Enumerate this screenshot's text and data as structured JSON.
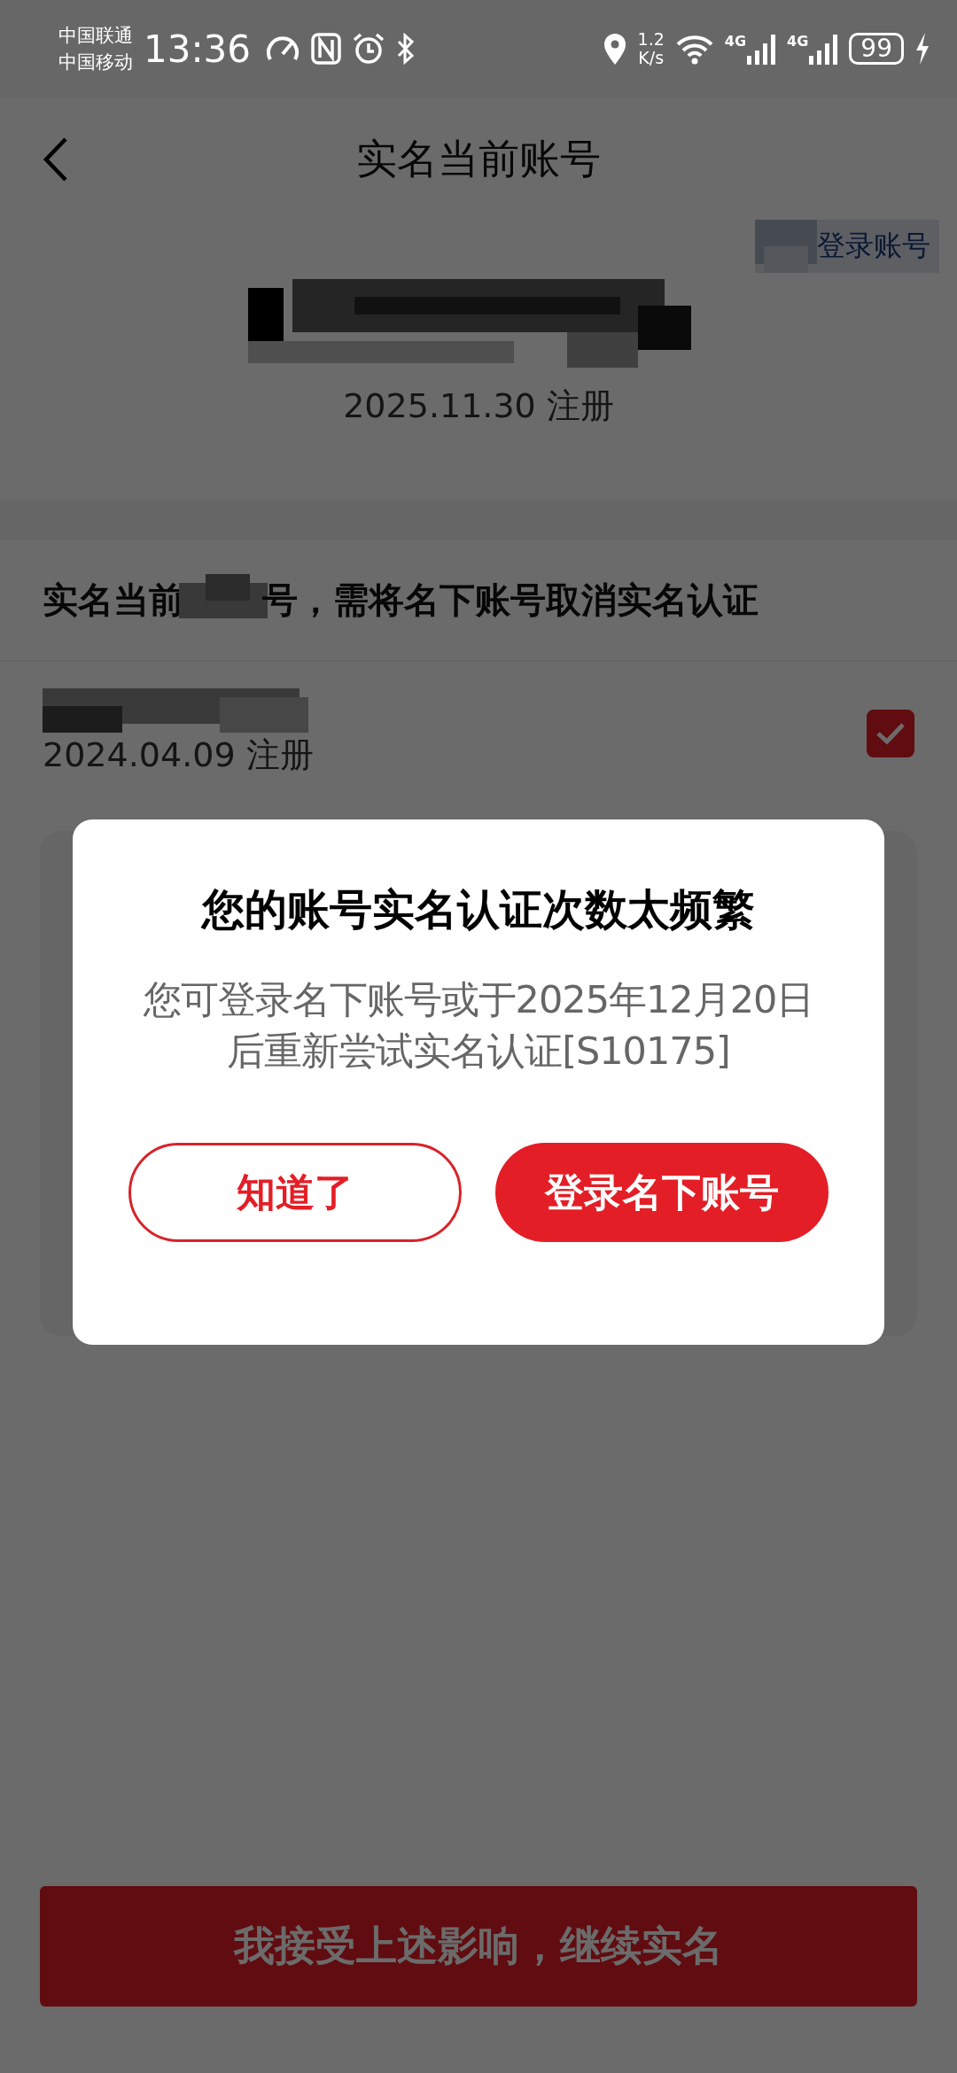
{
  "status_bar": {
    "carriers": [
      "中国联通",
      "中国移动"
    ],
    "time": "13:36",
    "speed_value": "1.2",
    "speed_unit": "K/s",
    "networks": [
      "4G",
      "4G"
    ],
    "battery": "99"
  },
  "header": {
    "title": "实名当前账号"
  },
  "current_account": {
    "switch_link": "登录账号",
    "registered": "2025.11.30 注册"
  },
  "section": {
    "heading_parts": [
      "实名当前",
      "号，需将名下账号取消实名认证"
    ]
  },
  "accounts": [
    {
      "registered": "2024.04.09 注册",
      "checked": true
    }
  ],
  "dialog": {
    "title": "您的账号实名认证次数太频繁",
    "message": "您可登录名下账号或于2025年12月20日后重新尝试实名认证[S10175]",
    "buttons": [
      {
        "label": "知道了",
        "kind": "secondary"
      },
      {
        "label": "登录名下账号",
        "kind": "primary"
      }
    ]
  },
  "confirm_button": {
    "label": "我接受上述影响，继续实名"
  }
}
